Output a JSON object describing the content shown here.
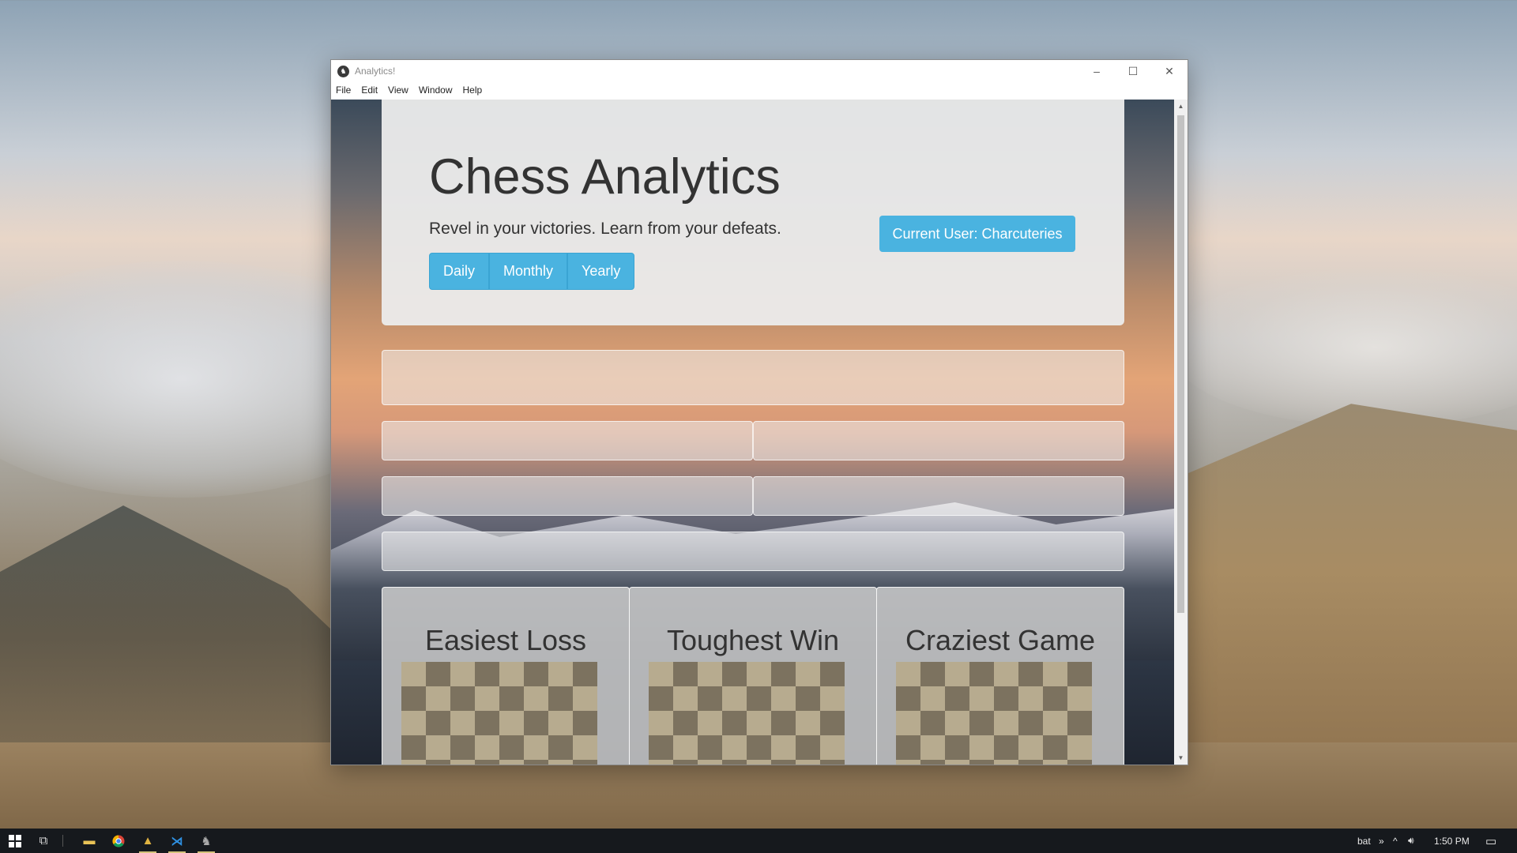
{
  "window": {
    "title": "Analytics!",
    "menu": [
      "File",
      "Edit",
      "View",
      "Window",
      "Help"
    ],
    "controls": {
      "minimize": "–",
      "maximize": "☐",
      "close": "✕"
    }
  },
  "header": {
    "title": "Chess Analytics",
    "tagline": "Revel in your victories. Learn from your defeats.",
    "period_buttons": [
      "Daily",
      "Monthly",
      "Yearly"
    ],
    "current_user_label": "Current User: Charcuteries"
  },
  "cards": [
    {
      "title": "Easiest Loss"
    },
    {
      "title": "Toughest Win"
    },
    {
      "title": "Craziest Game"
    }
  ],
  "taskbar": {
    "apps": [
      "start-icon",
      "task-view-icon",
      "file-explorer-icon",
      "chrome-icon",
      "kolibri-icon",
      "vscode-icon",
      "analytics-app-icon"
    ],
    "tray_user": "bat",
    "clock": "1:50 PM"
  },
  "colors": {
    "accent": "#4ab3e0",
    "taskbar": "#16191d"
  }
}
